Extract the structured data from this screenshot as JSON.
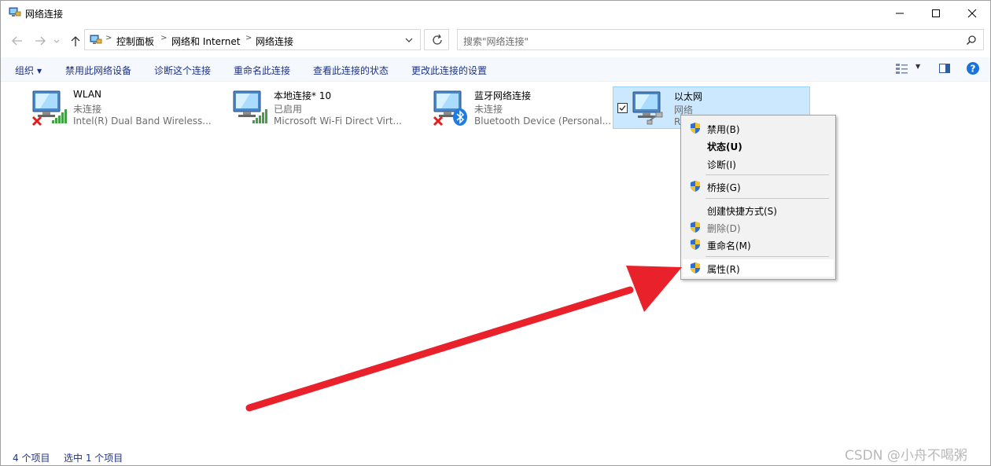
{
  "window": {
    "title": "网络连接"
  },
  "breadcrumb": [
    "控制面板",
    "网络和 Internet",
    "网络连接"
  ],
  "search": {
    "placeholder": "搜索\"网络连接\""
  },
  "toolbar": {
    "organize": "组织",
    "items": [
      "禁用此网络设备",
      "诊断这个连接",
      "重命名此连接",
      "查看此连接的状态",
      "更改此连接的设置"
    ]
  },
  "connections": [
    {
      "name": "WLAN",
      "status": "未连接",
      "device": "Intel(R) Dual Band Wireless...",
      "badge": "wifi-signal-icon",
      "disconnected": true
    },
    {
      "name": "本地连接* 10",
      "status": "已启用",
      "device": "Microsoft Wi-Fi Direct Virt...",
      "badge": "wifi-signal-icon",
      "disconnected": false
    },
    {
      "name": "蓝牙网络连接",
      "status": "未连接",
      "device": "Bluetooth Device (Personal...",
      "badge": "bluetooth-icon",
      "disconnected": true
    },
    {
      "name": "以太网",
      "status": "网络",
      "device": "R",
      "badge": "ethernet-cable-icon",
      "disconnected": false,
      "selected": true
    }
  ],
  "context_menu": {
    "items": [
      {
        "label": "禁用(B)",
        "shield": true
      },
      {
        "label": "状态(U)",
        "bold": true
      },
      {
        "label": "诊断(I)"
      },
      {
        "label": "桥接(G)",
        "shield": true
      },
      {
        "label": "创建快捷方式(S)"
      },
      {
        "label": "删除(D)",
        "shield": true,
        "disabled": true
      },
      {
        "label": "重命名(M)",
        "shield": true
      },
      {
        "label": "属性(R)",
        "shield": true,
        "highlighted": true
      }
    ]
  },
  "statusbar": {
    "item_count": "4 个项目",
    "selected_count": "选中 1 个项目"
  },
  "watermark": "CSDN @小舟不喝粥",
  "colors": {
    "accent": "#1e3287",
    "selection": "#cce8ff",
    "arrow": "#e8212b"
  }
}
